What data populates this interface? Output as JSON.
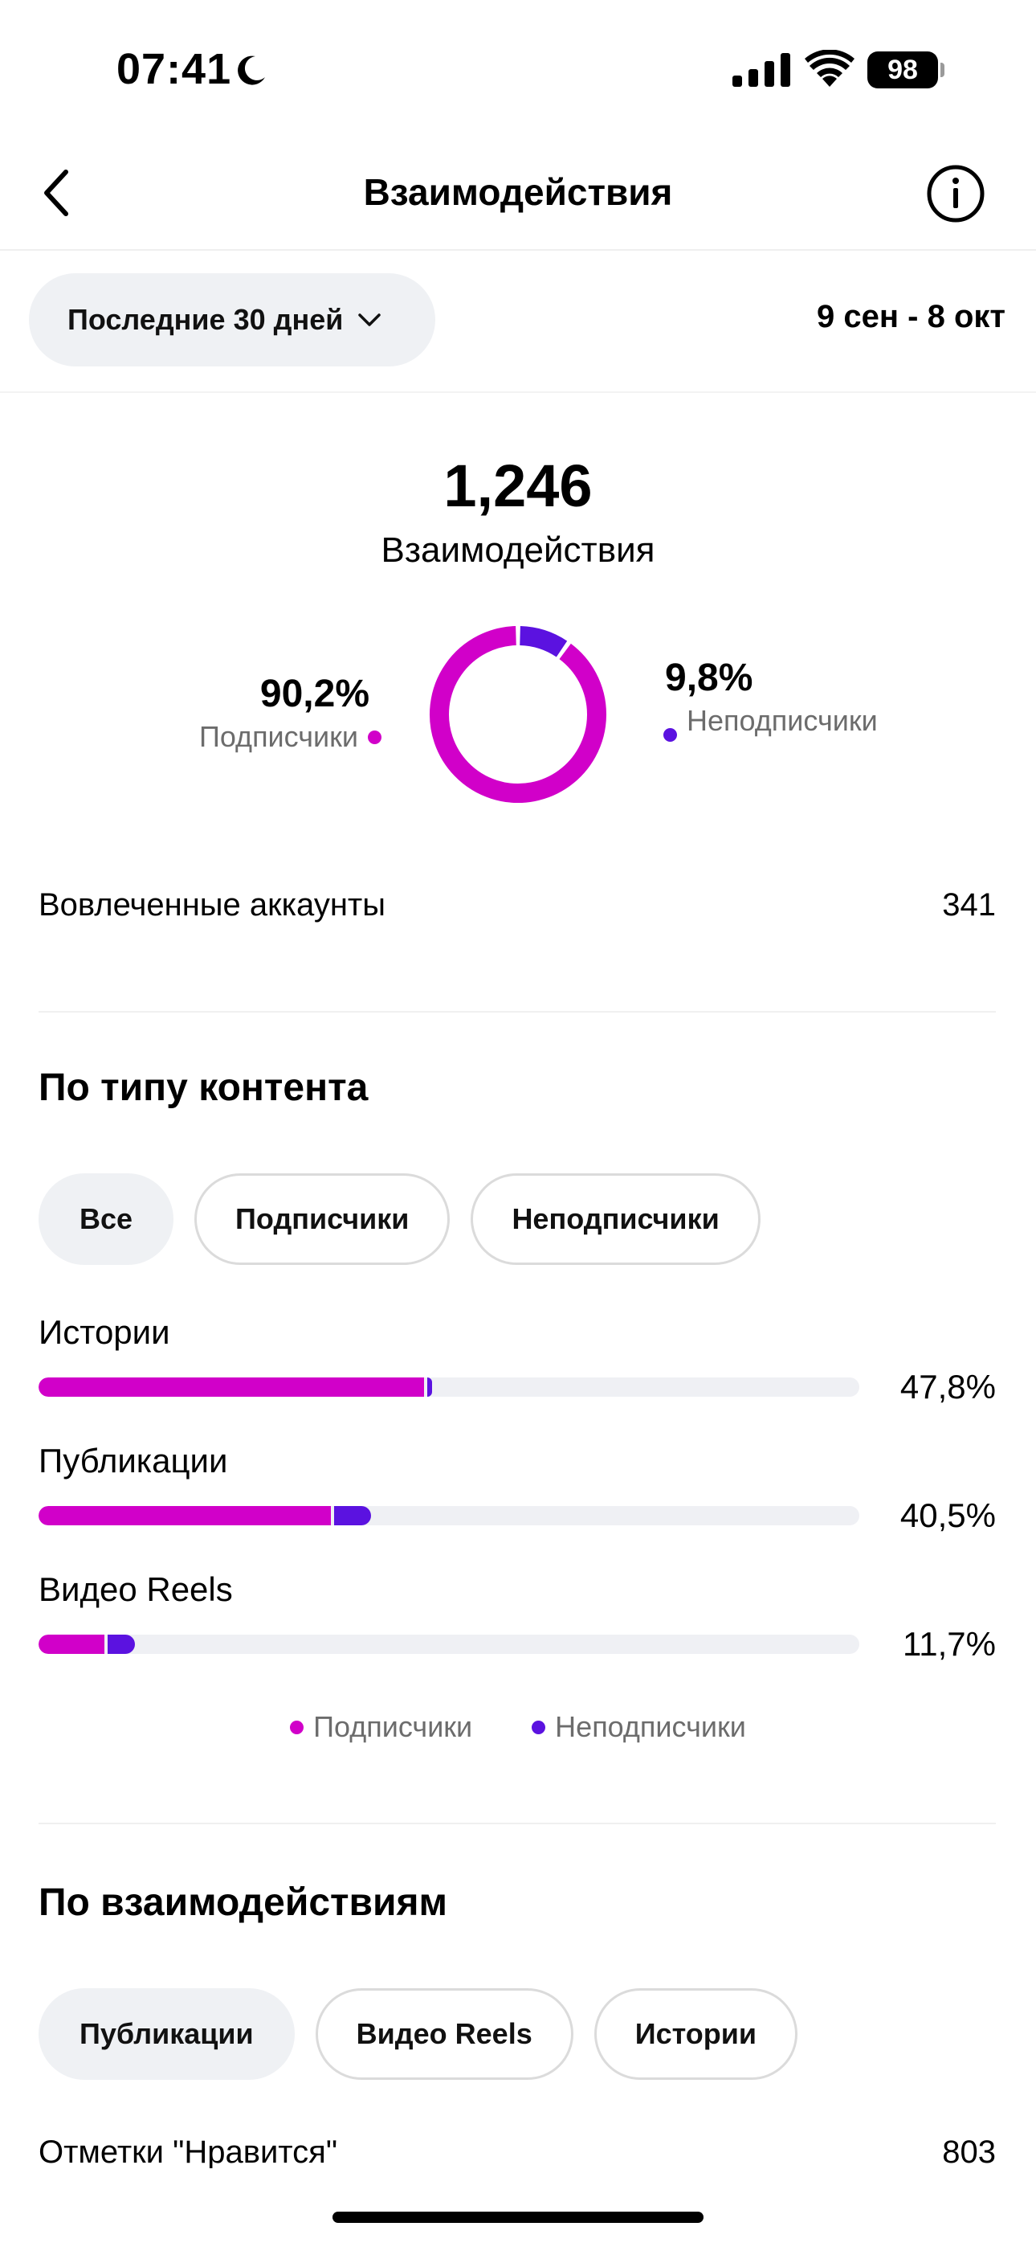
{
  "status_bar": {
    "time": "07:41",
    "battery": "98",
    "icons": [
      "moon-icon",
      "signal-icon",
      "wifi-icon",
      "battery-icon"
    ]
  },
  "header": {
    "title": "Взаимодействия",
    "back_icon": "chevron-left-icon",
    "info_icon": "info-icon"
  },
  "filter": {
    "period": "Последние 30 дней",
    "date_range": "9 сен - 8 окт"
  },
  "summary": {
    "total": "1,246",
    "label": "Взаимодействия",
    "followers_pct": "90,2%",
    "followers_label": "Подписчики",
    "nonfollowers_pct": "9,8%",
    "nonfollowers_label": "Неподписчики",
    "followers_fraction": 0.902,
    "nonfollowers_fraction": 0.098
  },
  "accounts": {
    "label": "Вовлеченные аккаунты",
    "value": "341"
  },
  "colors": {
    "followers": "#d100c9",
    "nonfollowers": "#5b12e0",
    "track": "#eff0f4"
  },
  "content_type": {
    "title": "По типу контента",
    "chips": [
      {
        "label": "Все",
        "selected": true
      },
      {
        "label": "Подписчики",
        "selected": false
      },
      {
        "label": "Неподписчики",
        "selected": false
      }
    ],
    "rows": [
      {
        "label": "Истории",
        "value": "47,8%",
        "followers": 47.0,
        "nonfollowers": 0.8
      },
      {
        "label": "Публикации",
        "value": "40,5%",
        "followers": 35.6,
        "nonfollowers": 4.9
      },
      {
        "label": "Видео Reels",
        "value": "11,7%",
        "followers": 8.0,
        "nonfollowers": 3.7
      }
    ],
    "legend": [
      "Подписчики",
      "Неподписчики"
    ]
  },
  "by_interaction": {
    "title": "По взаимодействиям",
    "chips": [
      {
        "label": "Публикации",
        "selected": true
      },
      {
        "label": "Видео Reels",
        "selected": false
      },
      {
        "label": "Истории",
        "selected": false
      }
    ],
    "likes_label": "Отметки \"Нравится\"",
    "likes_value": "803"
  }
}
